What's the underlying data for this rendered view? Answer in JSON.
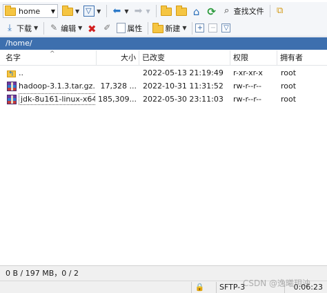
{
  "toolbar1": {
    "location_combo": "home",
    "find_files_label": "查找文件"
  },
  "toolbar2": {
    "download_label": "下载",
    "edit_label": "编辑",
    "properties_label": "属性",
    "new_label": "新建"
  },
  "path": "/home/",
  "columns": {
    "name": "名字",
    "size": "大小",
    "modified": "已改变",
    "permissions": "权限",
    "owner": "拥有者"
  },
  "files": [
    {
      "name": "..",
      "size": "",
      "modified": "2022-05-13 21:19:49",
      "permissions": "r-xr-xr-x",
      "owner": "root",
      "icon": "parent-folder-icon"
    },
    {
      "name": "hadoop-3.1.3.tar.gz...",
      "size": "17,328 ...",
      "modified": "2022-10-31 11:31:52",
      "permissions": "rw-r--r--",
      "owner": "root",
      "icon": "archive-icon"
    },
    {
      "name": "jdk-8u161-linux-x64...",
      "size": "185,309...",
      "modified": "2022-05-30 23:11:03",
      "permissions": "rw-r--r--",
      "owner": "root",
      "icon": "archive-icon"
    }
  ],
  "status": {
    "selection": "0 B / 197 MB，0 / 2",
    "protocol": "SFTP-3",
    "elapsed": "0:06:23"
  },
  "watermark": "CSDN @逸曦玥泱"
}
